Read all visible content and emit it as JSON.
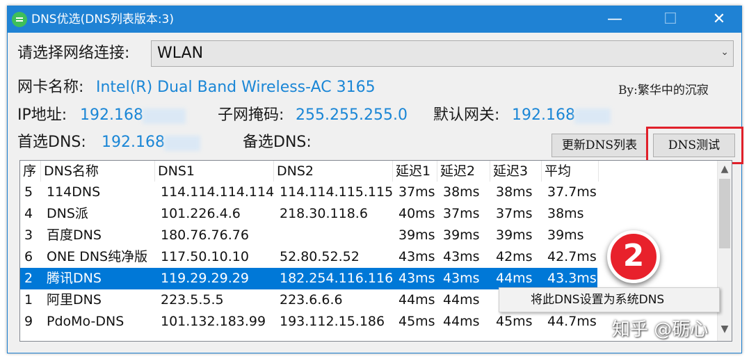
{
  "window": {
    "title": "DNS优选(DNS列表版本:3)",
    "controls": {
      "minimize": "—",
      "maximize": "☐",
      "close": "✕"
    }
  },
  "network": {
    "label": "请选择网络连接:",
    "selected": "WLAN"
  },
  "adapter": {
    "label": "网卡名称:",
    "value": "Intel(R) Dual Band Wireless-AC 3165"
  },
  "byline": "By:繁华中的沉寂",
  "ip": {
    "label": "IP地址:",
    "value": "192.168"
  },
  "subnet": {
    "label": "子网掩码:",
    "value": "255.255.255.0"
  },
  "gateway": {
    "label": "默认网关:",
    "value": "192.168"
  },
  "primary_dns": {
    "label": "首选DNS:",
    "value": "192.168"
  },
  "secondary_dns": {
    "label": "备选DNS:",
    "value": ""
  },
  "buttons": {
    "update_list": "更新DNS列表",
    "test": "DNS测试"
  },
  "table": {
    "headers": [
      "序",
      "DNS名称",
      "DNS1",
      "DNS2",
      "延迟1",
      "延迟2",
      "延迟3",
      "平均"
    ],
    "rows": [
      [
        "5",
        "114DNS",
        "114.114.114.114",
        "114.114.115.115",
        "37ms",
        "38ms",
        "38ms",
        "37.7ms"
      ],
      [
        "4",
        "DNS派",
        "101.226.4.6",
        "218.30.118.6",
        "40ms",
        "37ms",
        "37ms",
        "38ms"
      ],
      [
        "3",
        "百度DNS",
        "180.76.76.76",
        "",
        "39ms",
        "39ms",
        "39ms",
        "39ms"
      ],
      [
        "6",
        "ONE DNS纯净版",
        "117.50.10.10",
        "52.80.52.52",
        "43ms",
        "43ms",
        "42ms",
        "42.7ms"
      ],
      [
        "2",
        "腾讯DNS",
        "119.29.29.29",
        "182.254.116.116",
        "43ms",
        "43ms",
        "44ms",
        "43.3ms"
      ],
      [
        "1",
        "阿里DNS",
        "223.5.5.5",
        "223.6.6.6",
        "44ms",
        "44ms",
        "",
        ""
      ],
      [
        "9",
        "PdoMo-DNS",
        "101.132.183.99",
        "193.112.15.186",
        "45ms",
        "44ms",
        "45ms",
        "44.7ms"
      ]
    ],
    "selected_row": 4
  },
  "badge": "2",
  "context_menu": {
    "set_system_dns": "将此DNS设置为系统DNS"
  },
  "watermark": "知乎 @砺心",
  "colors": {
    "titlebar": "#1f82d4",
    "value_text": "#1a86d6",
    "selection": "#0078d7",
    "highlight_box": "#e0202a",
    "badge": "#e8212b"
  }
}
